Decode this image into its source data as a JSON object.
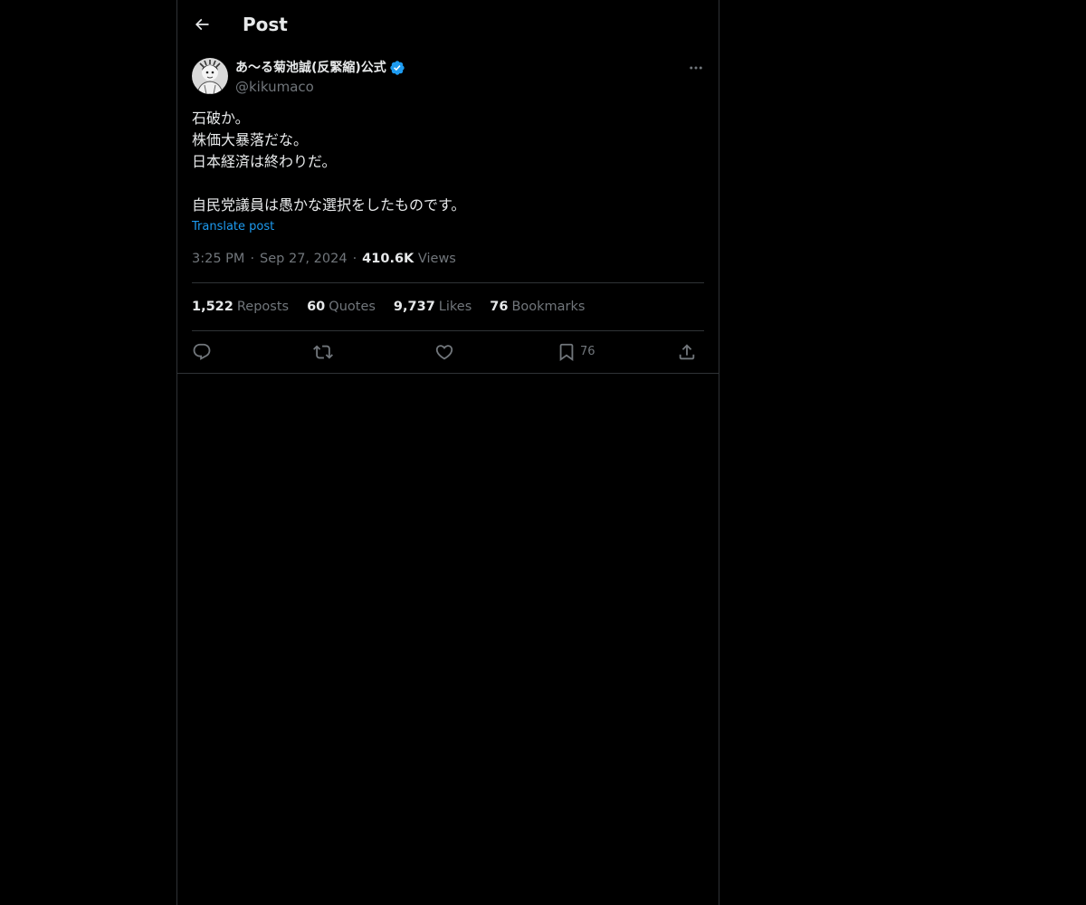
{
  "header": {
    "back_icon": "arrow-left-icon",
    "title": "Post"
  },
  "post": {
    "author": {
      "display_name": "あ〜る菊池誠(反緊縮)公式",
      "handle": "@kikumaco",
      "verified": true,
      "verified_color": "#1d9bf0"
    },
    "text_lines": [
      "石破か。",
      "株価大暴落だな。",
      "日本経済は終わりだ。",
      "",
      "自民党議員は愚かな選択をしたものです。"
    ],
    "translate_label": "Translate post",
    "time": "3:25 PM",
    "date": "Sep 27, 2024",
    "views_count": "410.6K",
    "views_label": "Views",
    "stats": {
      "reposts": {
        "count": "1,522",
        "label": "Reposts"
      },
      "quotes": {
        "count": "60",
        "label": "Quotes"
      },
      "likes": {
        "count": "9,737",
        "label": "Likes"
      },
      "bookmarks": {
        "count": "76",
        "label": "Bookmarks"
      }
    },
    "actions": {
      "reply_icon": "reply-icon",
      "repost_icon": "repost-icon",
      "like_icon": "heart-icon",
      "bookmark_icon": "bookmark-icon",
      "bookmark_count": "76",
      "share_icon": "share-icon"
    }
  },
  "colors": {
    "background": "#000000",
    "text_primary": "#e7e9ea",
    "text_secondary": "#71767b",
    "accent": "#1d9bf0",
    "border": "#2f3336"
  }
}
